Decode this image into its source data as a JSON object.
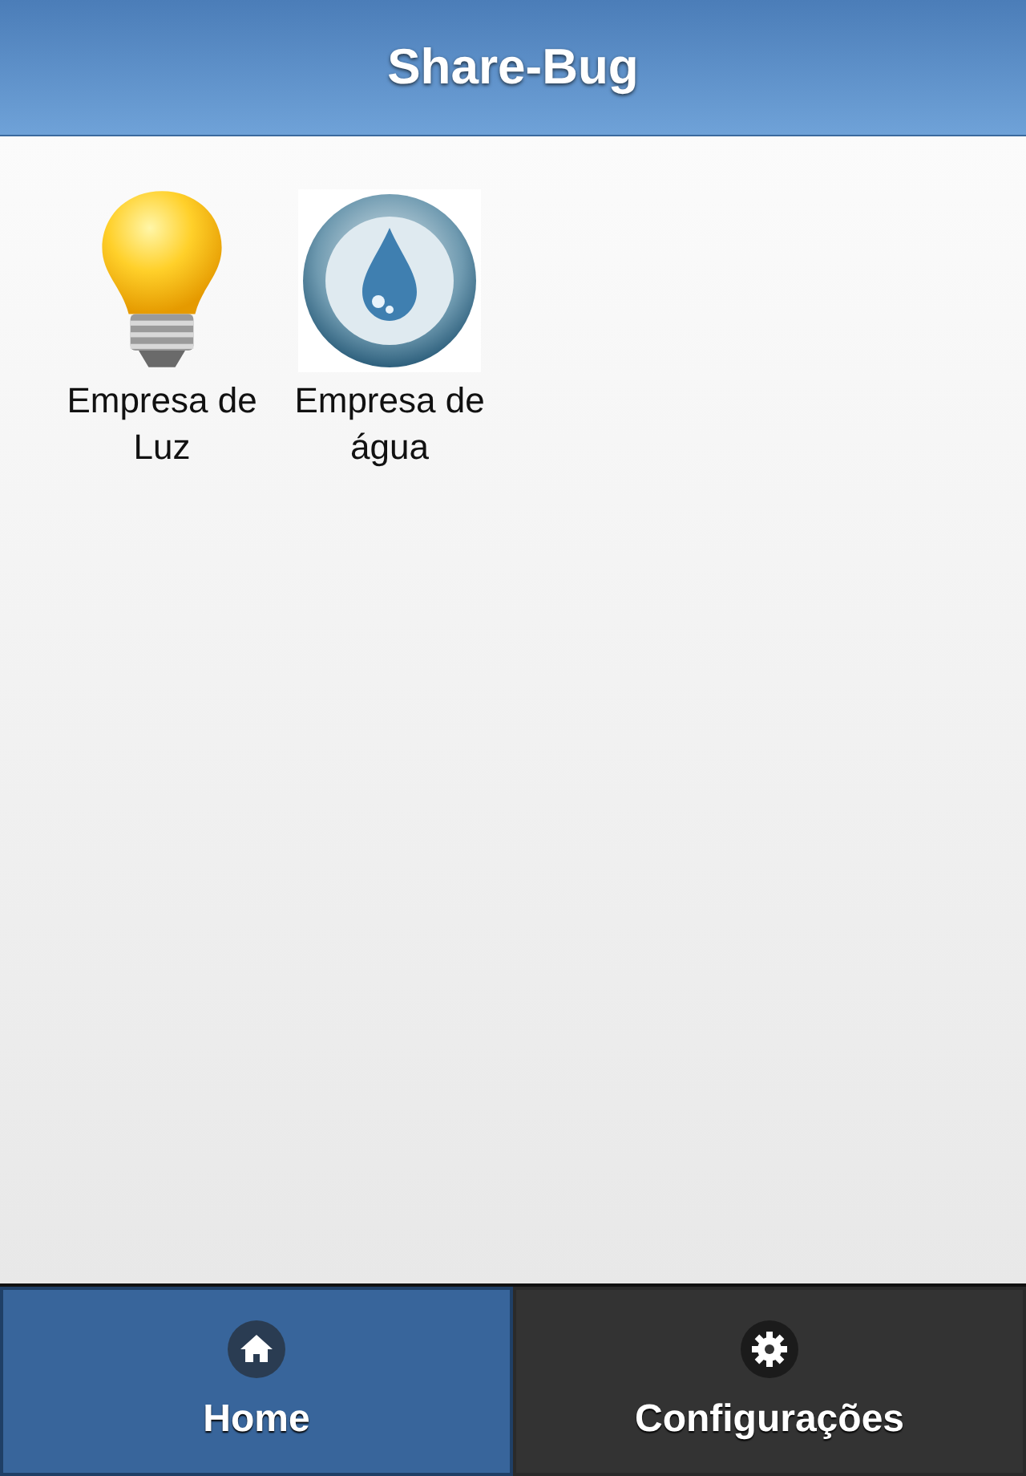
{
  "header": {
    "title": "Share-Bug"
  },
  "items": [
    {
      "kind": "bulb",
      "label": "Empresa de Luz"
    },
    {
      "kind": "water",
      "label": "Empresa de água"
    }
  ],
  "tabs": [
    {
      "kind": "home",
      "label": "Home",
      "selected": true
    },
    {
      "kind": "gear",
      "label": "Configurações",
      "selected": false
    }
  ]
}
